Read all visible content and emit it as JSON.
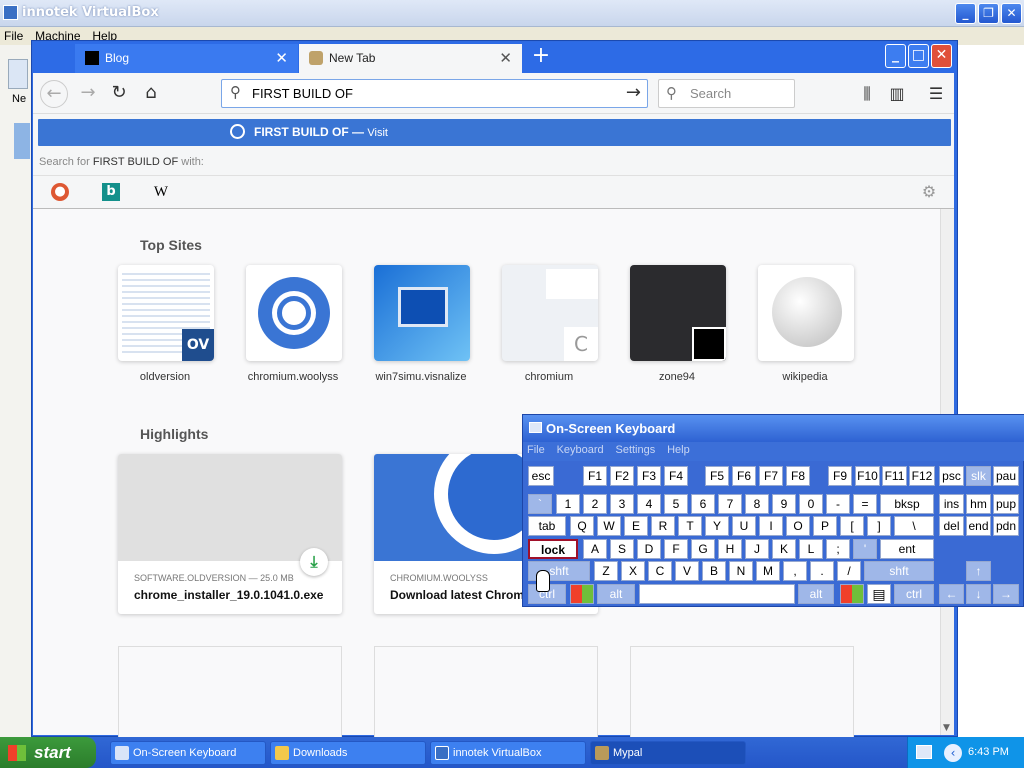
{
  "vbox": {
    "title": "innotek VirtualBox",
    "menu": [
      "File",
      "Machine",
      "Help"
    ],
    "side_label": "Ne"
  },
  "browser": {
    "tabs": [
      {
        "label": "Blog"
      },
      {
        "label": "New Tab"
      }
    ],
    "url_value": "FIRST BUILD OF ",
    "search_placeholder": "Search"
  },
  "dropdown": {
    "query": "FIRST BUILD OF",
    "dash": "—",
    "visit": "Visit",
    "hint_prefix": "Search for",
    "hint_suffix": "with:",
    "engines": [
      "DuckDuckGo",
      "Bing",
      "W"
    ]
  },
  "newtab": {
    "top_sites_heading": "Top Sites",
    "top_sites": [
      {
        "label": "oldversion",
        "badge": "OV"
      },
      {
        "label": "chromium.woolyss"
      },
      {
        "label": "win7simu.visnalize"
      },
      {
        "label": "chromium",
        "badge": "C"
      },
      {
        "label": "zone94"
      },
      {
        "label": "wikipedia"
      }
    ],
    "highlights_heading": "Highlights",
    "highlights": [
      {
        "source": "SOFTWARE.OLDVERSION — 25.0 MB",
        "title": "chrome_installer_19.0.1041.0.exe"
      },
      {
        "source": "CHROMIUM.WOOLYSS",
        "title": "Download latest Chrom"
      }
    ]
  },
  "osk": {
    "title": "On-Screen Keyboard",
    "menu": [
      "File",
      "Keyboard",
      "Settings",
      "Help"
    ],
    "rows": [
      [
        "esc",
        "F1",
        "F2",
        "F3",
        "F4",
        "F5",
        "F6",
        "F7",
        "F8",
        "F9",
        "F10",
        "F11",
        "F12",
        "psc",
        "slk",
        "pau"
      ],
      [
        "`",
        "1",
        "2",
        "3",
        "4",
        "5",
        "6",
        "7",
        "8",
        "9",
        "0",
        "-",
        "=",
        "bksp",
        "ins",
        "hm",
        "pup"
      ],
      [
        "tab",
        "q",
        "w",
        "e",
        "r",
        "t",
        "y",
        "u",
        "i",
        "o",
        "p",
        "[",
        "]",
        "\\",
        "del",
        "end",
        "pdn"
      ],
      [
        "lock",
        "a",
        "s",
        "d",
        "f",
        "g",
        "h",
        "j",
        "k",
        "l",
        ";",
        "'",
        "ent"
      ],
      [
        "shft",
        "z",
        "x",
        "c",
        "v",
        "b",
        "n",
        "m",
        ",",
        ".",
        "/",
        "shft",
        "↑"
      ],
      [
        "ctrl",
        "alt",
        "alt",
        "ctrl",
        "←",
        "↓",
        "→"
      ]
    ]
  },
  "taskbar": {
    "start": "start",
    "tasks": [
      "On-Screen Keyboard",
      "Downloads",
      "innotek VirtualBox",
      "Mypal"
    ],
    "clock": "6:43 PM"
  }
}
